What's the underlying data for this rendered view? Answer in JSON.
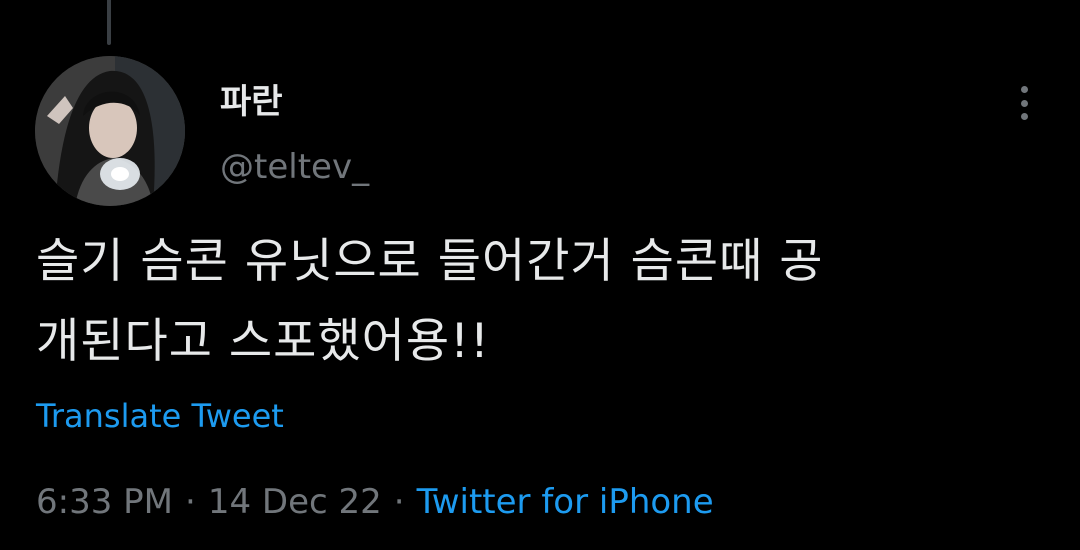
{
  "tweet": {
    "display_name": "파란",
    "handle": "@teltev_",
    "text_lines": [
      "슬기 슴콘 유닛으로 들어간거 슴콘때 공",
      "개된다고 스포했어용!!"
    ],
    "translate_label": "Translate Tweet",
    "time": "6:33 PM",
    "separator": "·",
    "date": "14 Dec 22",
    "source": "Twitter for iPhone"
  },
  "icons": {
    "more": "more-vertical-icon",
    "avatar": "avatar-photo"
  },
  "colors": {
    "background": "#000000",
    "primary_text": "#e7e9ea",
    "secondary_text": "#71767b",
    "accent": "#1d9bf0"
  }
}
